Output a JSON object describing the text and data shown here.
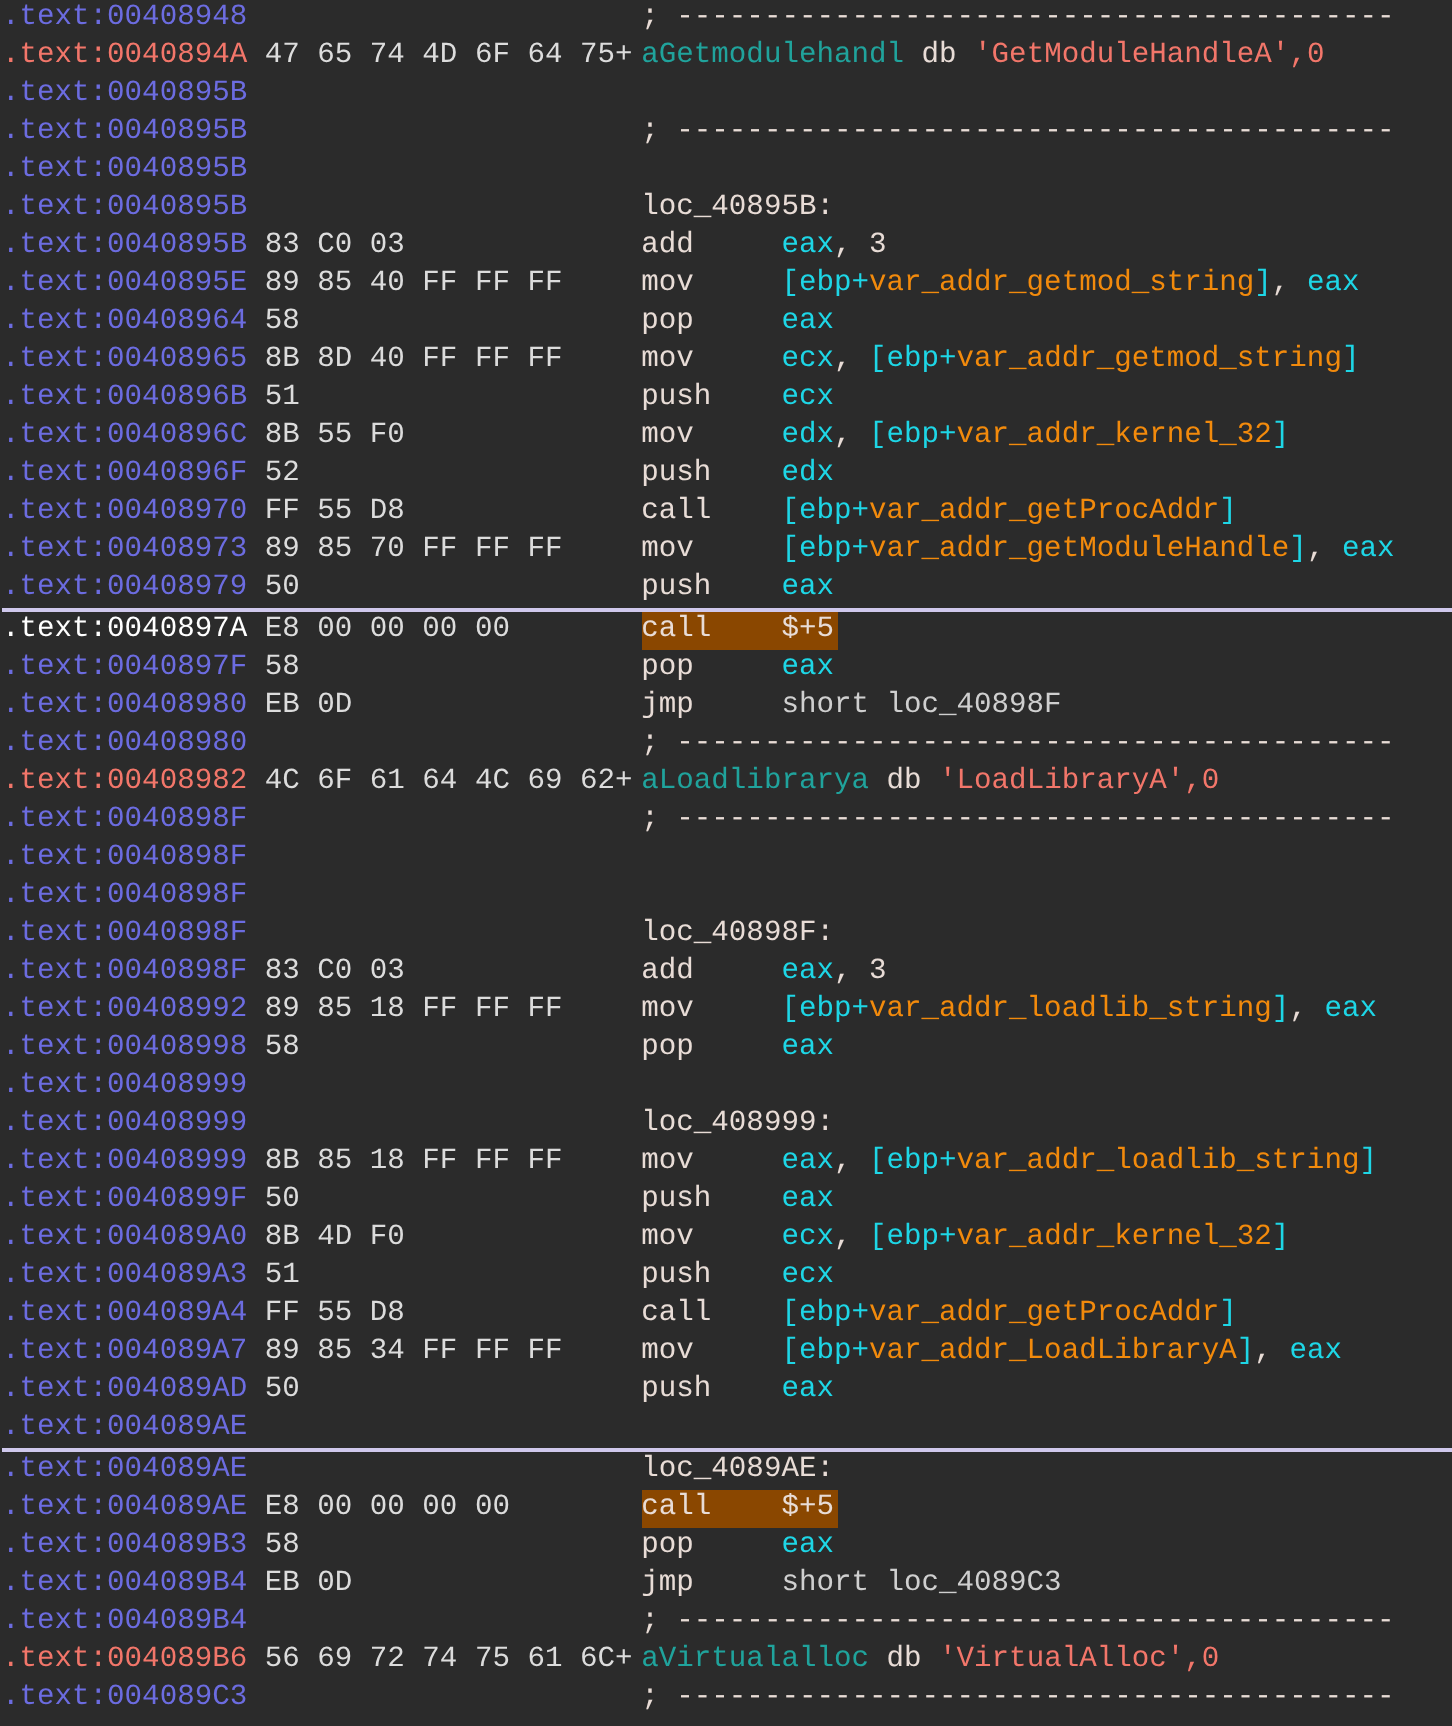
{
  "lines": [
    {
      "address": ".text:00408948",
      "kind": "code",
      "tokens": [
        {
          "text": "; -----------------------------------------",
          "kind": "comment"
        }
      ]
    },
    {
      "address": ".text:0040894A",
      "kind": "data",
      "bytes": "47 65 74 4D 6F 64 75+",
      "tokens": [
        {
          "text": "aGetmodulehandl",
          "kind": "name"
        },
        {
          "text": " db ",
          "kind": "plain"
        },
        {
          "text": "'GetModuleHandleA',0",
          "kind": "string"
        }
      ]
    },
    {
      "address": ".text:0040895B",
      "kind": "code"
    },
    {
      "address": ".text:0040895B",
      "kind": "code",
      "tokens": [
        {
          "text": "; -----------------------------------------",
          "kind": "comment"
        }
      ]
    },
    {
      "address": ".text:0040895B",
      "kind": "code"
    },
    {
      "address": ".text:0040895B",
      "kind": "code",
      "tokens": [
        {
          "text": "loc_40895B:",
          "kind": "label"
        }
      ]
    },
    {
      "address": ".text:0040895B",
      "kind": "code",
      "bytes": "83 C0 03",
      "mnemonic": "add",
      "highlighted": false,
      "tokens": [
        {
          "text": "eax",
          "kind": "reg"
        },
        {
          "text": ", 3",
          "kind": "plain"
        }
      ]
    },
    {
      "address": ".text:0040895E",
      "kind": "code",
      "bytes": "89 85 40 FF FF FF",
      "mnemonic": "mov",
      "highlighted": false,
      "tokens": [
        {
          "text": "[ebp+",
          "kind": "reg"
        },
        {
          "text": "var_addr_getmod_string",
          "kind": "var"
        },
        {
          "text": "]",
          "kind": "reg"
        },
        {
          "text": ", ",
          "kind": "plain"
        },
        {
          "text": "eax",
          "kind": "reg"
        }
      ]
    },
    {
      "address": ".text:00408964",
      "kind": "code",
      "bytes": "58",
      "mnemonic": "pop",
      "highlighted": false,
      "tokens": [
        {
          "text": "eax",
          "kind": "reg"
        }
      ]
    },
    {
      "address": ".text:00408965",
      "kind": "code",
      "bytes": "8B 8D 40 FF FF FF",
      "mnemonic": "mov",
      "highlighted": false,
      "tokens": [
        {
          "text": "ecx",
          "kind": "reg"
        },
        {
          "text": ", ",
          "kind": "plain"
        },
        {
          "text": "[ebp+",
          "kind": "reg"
        },
        {
          "text": "var_addr_getmod_string",
          "kind": "var"
        },
        {
          "text": "]",
          "kind": "reg"
        }
      ]
    },
    {
      "address": ".text:0040896B",
      "kind": "code",
      "bytes": "51",
      "mnemonic": "push",
      "highlighted": false,
      "tokens": [
        {
          "text": "ecx",
          "kind": "reg"
        }
      ]
    },
    {
      "address": ".text:0040896C",
      "kind": "code",
      "bytes": "8B 55 F0",
      "mnemonic": "mov",
      "highlighted": false,
      "tokens": [
        {
          "text": "edx",
          "kind": "reg"
        },
        {
          "text": ", ",
          "kind": "plain"
        },
        {
          "text": "[ebp+",
          "kind": "reg"
        },
        {
          "text": "var_addr_kernel_32",
          "kind": "var"
        },
        {
          "text": "]",
          "kind": "reg"
        }
      ]
    },
    {
      "address": ".text:0040896F",
      "kind": "code",
      "bytes": "52",
      "mnemonic": "push",
      "highlighted": false,
      "tokens": [
        {
          "text": "edx",
          "kind": "reg"
        }
      ]
    },
    {
      "address": ".text:00408970",
      "kind": "code",
      "bytes": "FF 55 D8",
      "mnemonic": "call",
      "highlighted": false,
      "tokens": [
        {
          "text": "[ebp+",
          "kind": "reg"
        },
        {
          "text": "var_addr_getProcAddr",
          "kind": "var"
        },
        {
          "text": "]",
          "kind": "reg"
        }
      ]
    },
    {
      "address": ".text:00408973",
      "kind": "code",
      "bytes": "89 85 70 FF FF FF",
      "mnemonic": "mov",
      "highlighted": false,
      "tokens": [
        {
          "text": "[ebp+",
          "kind": "reg"
        },
        {
          "text": "var_addr_getModuleHandle",
          "kind": "var"
        },
        {
          "text": "]",
          "kind": "reg"
        },
        {
          "text": ", ",
          "kind": "plain"
        },
        {
          "text": "eax",
          "kind": "reg"
        }
      ]
    },
    {
      "address": ".text:00408979",
      "kind": "code",
      "bytes": "50",
      "mnemonic": "push",
      "highlighted": false,
      "divider_below": true,
      "tokens": [
        {
          "text": "eax",
          "kind": "reg"
        }
      ]
    },
    {
      "address": ".text:0040897A",
      "kind": "current",
      "bytes": "E8 00 00 00 00",
      "mnemonic": "call",
      "highlighted": true,
      "tokens": [
        {
          "text": "$+5",
          "kind": "plain"
        }
      ]
    },
    {
      "address": ".text:0040897F",
      "kind": "code",
      "bytes": "58",
      "mnemonic": "pop",
      "highlighted": false,
      "tokens": [
        {
          "text": "eax",
          "kind": "reg"
        }
      ]
    },
    {
      "address": ".text:00408980",
      "kind": "code",
      "bytes": "EB 0D",
      "mnemonic": "jmp",
      "highlighted": false,
      "tokens": [
        {
          "text": "short loc_40898F",
          "kind": "ref"
        }
      ]
    },
    {
      "address": ".text:00408980",
      "kind": "code",
      "tokens": [
        {
          "text": "; -----------------------------------------",
          "kind": "comment"
        }
      ]
    },
    {
      "address": ".text:00408982",
      "kind": "data",
      "bytes": "4C 6F 61 64 4C 69 62+",
      "tokens": [
        {
          "text": "aLoadlibrarya",
          "kind": "name"
        },
        {
          "text": " db ",
          "kind": "plain"
        },
        {
          "text": "'LoadLibraryA',0",
          "kind": "string"
        }
      ]
    },
    {
      "address": ".text:0040898F",
      "kind": "code",
      "tokens": [
        {
          "text": "; -----------------------------------------",
          "kind": "comment"
        }
      ]
    },
    {
      "address": ".text:0040898F",
      "kind": "code"
    },
    {
      "address": ".text:0040898F",
      "kind": "code"
    },
    {
      "address": ".text:0040898F",
      "kind": "code",
      "tokens": [
        {
          "text": "loc_40898F:",
          "kind": "label"
        }
      ]
    },
    {
      "address": ".text:0040898F",
      "kind": "code",
      "bytes": "83 C0 03",
      "mnemonic": "add",
      "highlighted": false,
      "tokens": [
        {
          "text": "eax",
          "kind": "reg"
        },
        {
          "text": ", 3",
          "kind": "plain"
        }
      ]
    },
    {
      "address": ".text:00408992",
      "kind": "code",
      "bytes": "89 85 18 FF FF FF",
      "mnemonic": "mov",
      "highlighted": false,
      "tokens": [
        {
          "text": "[ebp+",
          "kind": "reg"
        },
        {
          "text": "var_addr_loadlib_string",
          "kind": "var"
        },
        {
          "text": "]",
          "kind": "reg"
        },
        {
          "text": ", ",
          "kind": "plain"
        },
        {
          "text": "eax",
          "kind": "reg"
        }
      ]
    },
    {
      "address": ".text:00408998",
      "kind": "code",
      "bytes": "58",
      "mnemonic": "pop",
      "highlighted": false,
      "tokens": [
        {
          "text": "eax",
          "kind": "reg"
        }
      ]
    },
    {
      "address": ".text:00408999",
      "kind": "code"
    },
    {
      "address": ".text:00408999",
      "kind": "code",
      "tokens": [
        {
          "text": "loc_408999:",
          "kind": "label"
        }
      ]
    },
    {
      "address": ".text:00408999",
      "kind": "code",
      "bytes": "8B 85 18 FF FF FF",
      "mnemonic": "mov",
      "highlighted": false,
      "tokens": [
        {
          "text": "eax",
          "kind": "reg"
        },
        {
          "text": ", ",
          "kind": "plain"
        },
        {
          "text": "[ebp+",
          "kind": "reg"
        },
        {
          "text": "var_addr_loadlib_string",
          "kind": "var"
        },
        {
          "text": "]",
          "kind": "reg"
        }
      ]
    },
    {
      "address": ".text:0040899F",
      "kind": "code",
      "bytes": "50",
      "mnemonic": "push",
      "highlighted": false,
      "tokens": [
        {
          "text": "eax",
          "kind": "reg"
        }
      ]
    },
    {
      "address": ".text:004089A0",
      "kind": "code",
      "bytes": "8B 4D F0",
      "mnemonic": "mov",
      "highlighted": false,
      "tokens": [
        {
          "text": "ecx",
          "kind": "reg"
        },
        {
          "text": ", ",
          "kind": "plain"
        },
        {
          "text": "[ebp+",
          "kind": "reg"
        },
        {
          "text": "var_addr_kernel_32",
          "kind": "var"
        },
        {
          "text": "]",
          "kind": "reg"
        }
      ]
    },
    {
      "address": ".text:004089A3",
      "kind": "code",
      "bytes": "51",
      "mnemonic": "push",
      "highlighted": false,
      "tokens": [
        {
          "text": "ecx",
          "kind": "reg"
        }
      ]
    },
    {
      "address": ".text:004089A4",
      "kind": "code",
      "bytes": "FF 55 D8",
      "mnemonic": "call",
      "highlighted": false,
      "tokens": [
        {
          "text": "[ebp+",
          "kind": "reg"
        },
        {
          "text": "var_addr_getProcAddr",
          "kind": "var"
        },
        {
          "text": "]",
          "kind": "reg"
        }
      ]
    },
    {
      "address": ".text:004089A7",
      "kind": "code",
      "bytes": "89 85 34 FF FF FF",
      "mnemonic": "mov",
      "highlighted": false,
      "tokens": [
        {
          "text": "[ebp+",
          "kind": "reg"
        },
        {
          "text": "var_addr_LoadLibraryA",
          "kind": "var"
        },
        {
          "text": "]",
          "kind": "reg"
        },
        {
          "text": ", ",
          "kind": "plain"
        },
        {
          "text": "eax",
          "kind": "reg"
        }
      ]
    },
    {
      "address": ".text:004089AD",
      "kind": "code",
      "bytes": "50",
      "mnemonic": "push",
      "highlighted": false,
      "tokens": [
        {
          "text": "eax",
          "kind": "reg"
        }
      ]
    },
    {
      "address": ".text:004089AE",
      "kind": "code",
      "divider_below": true
    },
    {
      "address": ".text:004089AE",
      "kind": "code",
      "tokens": [
        {
          "text": "loc_4089AE:",
          "kind": "label"
        }
      ]
    },
    {
      "address": ".text:004089AE",
      "kind": "code",
      "bytes": "E8 00 00 00 00",
      "mnemonic": "call",
      "highlighted": true,
      "tokens": [
        {
          "text": "$+5",
          "kind": "plain"
        }
      ]
    },
    {
      "address": ".text:004089B3",
      "kind": "code",
      "bytes": "58",
      "mnemonic": "pop",
      "highlighted": false,
      "tokens": [
        {
          "text": "eax",
          "kind": "reg"
        }
      ]
    },
    {
      "address": ".text:004089B4",
      "kind": "code",
      "bytes": "EB 0D",
      "mnemonic": "jmp",
      "highlighted": false,
      "tokens": [
        {
          "text": "short loc_4089C3",
          "kind": "ref"
        }
      ]
    },
    {
      "address": ".text:004089B4",
      "kind": "code",
      "tokens": [
        {
          "text": "; -----------------------------------------",
          "kind": "comment"
        }
      ]
    },
    {
      "address": ".text:004089B6",
      "kind": "data",
      "bytes": "56 69 72 74 75 61 6C+",
      "tokens": [
        {
          "text": "aVirtualalloc",
          "kind": "name"
        },
        {
          "text": " db ",
          "kind": "plain"
        },
        {
          "text": "'VirtualAlloc',0",
          "kind": "string"
        }
      ]
    },
    {
      "address": ".text:004089C3",
      "kind": "code",
      "tokens": [
        {
          "text": "; -----------------------------------------",
          "kind": "comment"
        }
      ]
    }
  ]
}
